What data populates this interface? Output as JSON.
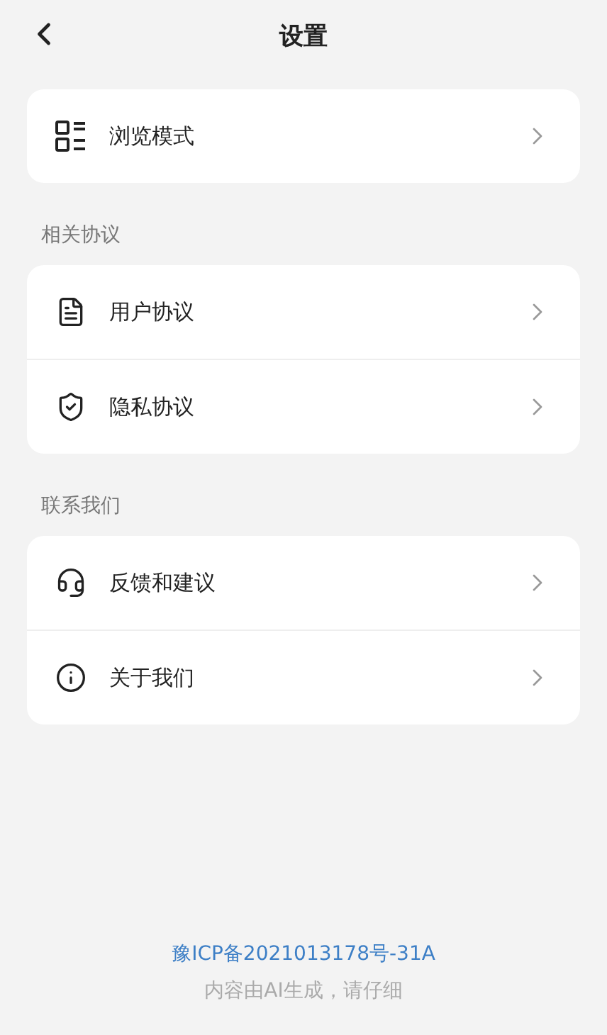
{
  "header": {
    "title": "设置"
  },
  "sections": [
    {
      "items": [
        {
          "label": "浏览模式"
        }
      ]
    },
    {
      "heading": "相关协议",
      "items": [
        {
          "label": "用户协议"
        },
        {
          "label": "隐私协议"
        }
      ]
    },
    {
      "heading": "联系我们",
      "items": [
        {
          "label": "反馈和建议"
        },
        {
          "label": "关于我们"
        }
      ]
    }
  ],
  "footer": {
    "license": "豫ICP备2021013178号-31A",
    "notice": "内容由AI生成，请仔细"
  }
}
